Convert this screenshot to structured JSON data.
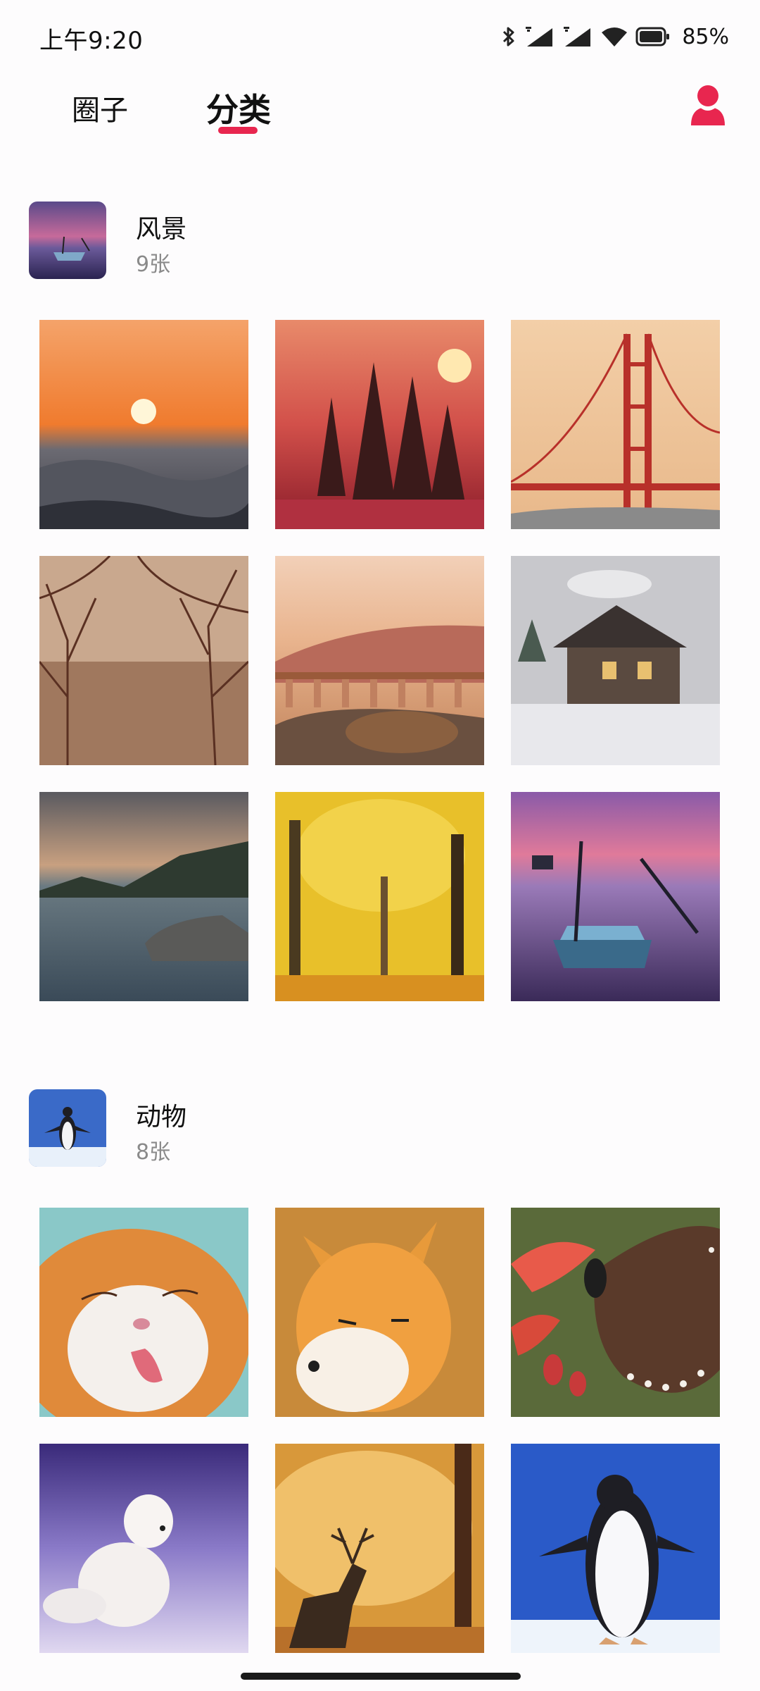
{
  "status_bar": {
    "time": "上午9:20",
    "battery": "85%"
  },
  "nav": {
    "tabs": [
      {
        "label": "圈子"
      },
      {
        "label": "分类"
      }
    ],
    "active_tab": "分类",
    "accent_color": "#e8264f"
  },
  "categories": [
    {
      "title": "风景",
      "count": "9张",
      "photos": [
        "sunset-over-sea",
        "red-forest-sunrise",
        "golden-gate-bridge",
        "misty-bare-trees",
        "stone-viaduct-mountains",
        "snowy-log-cabin",
        "lake-rocky-shore",
        "yellow-autumn-forest",
        "rowboat-purple-lake"
      ]
    },
    {
      "title": "动物",
      "count": "8张",
      "photos": [
        "orange-cat-licking",
        "red-fox",
        "brown-butterfly-red-flower",
        "arctic-fox-snow",
        "deer-autumn-forest",
        "penguin-snow"
      ]
    }
  ]
}
